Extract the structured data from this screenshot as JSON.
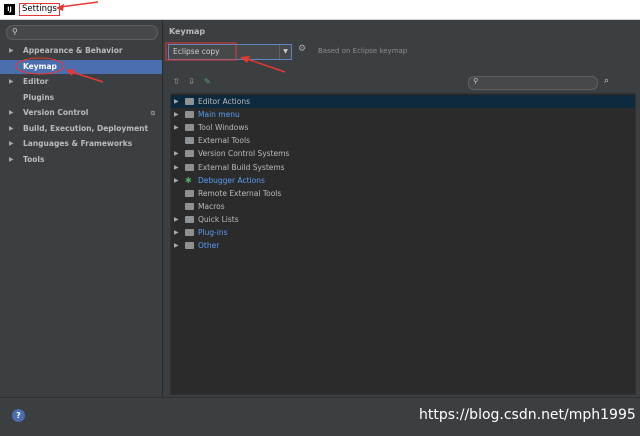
{
  "window": {
    "title": "Settings",
    "app_icon": "IJ"
  },
  "sidebar": {
    "search_placeholder": "",
    "items": [
      {
        "label": "Appearance & Behavior",
        "expand": "▶",
        "selected": false
      },
      {
        "label": "Keymap",
        "expand": "",
        "selected": true
      },
      {
        "label": "Editor",
        "expand": "▶",
        "selected": false
      },
      {
        "label": "Plugins",
        "expand": "",
        "selected": false
      },
      {
        "label": "Version Control",
        "expand": "▶",
        "selected": false
      },
      {
        "label": "Build, Execution, Deployment",
        "expand": "▶",
        "selected": false
      },
      {
        "label": "Languages & Frameworks",
        "expand": "▶",
        "selected": false
      },
      {
        "label": "Tools",
        "expand": "▶",
        "selected": false
      }
    ]
  },
  "main": {
    "heading": "Keymap",
    "keymap_select": "Eclipse copy",
    "based_on": "Based on Eclipse keymap",
    "tree": [
      {
        "label": "Editor Actions",
        "expand": "▶",
        "link": false,
        "icon": "folder"
      },
      {
        "label": "Main menu",
        "expand": "▶",
        "link": true,
        "icon": "folder"
      },
      {
        "label": "Tool Windows",
        "expand": "▶",
        "link": false,
        "icon": "folder"
      },
      {
        "label": "External Tools",
        "expand": "",
        "link": false,
        "icon": "folder"
      },
      {
        "label": "Version Control Systems",
        "expand": "▶",
        "link": false,
        "icon": "folder"
      },
      {
        "label": "External Build Systems",
        "expand": "▶",
        "link": false,
        "icon": "folder"
      },
      {
        "label": "Debugger Actions",
        "expand": "▶",
        "link": true,
        "icon": "bug"
      },
      {
        "label": "Remote External Tools",
        "expand": "",
        "link": false,
        "icon": "folder"
      },
      {
        "label": "Macros",
        "expand": "",
        "link": false,
        "icon": "folder"
      },
      {
        "label": "Quick Lists",
        "expand": "▶",
        "link": false,
        "icon": "folder"
      },
      {
        "label": "Plug-ins",
        "expand": "▶",
        "link": true,
        "icon": "folder"
      },
      {
        "label": "Other",
        "expand": "▶",
        "link": true,
        "icon": "folder"
      }
    ]
  },
  "watermark": "https://blog.csdn.net/mph1995",
  "colors": {
    "accent": "#4b6eaf",
    "link": "#589df6",
    "annotation": "#e53935"
  }
}
